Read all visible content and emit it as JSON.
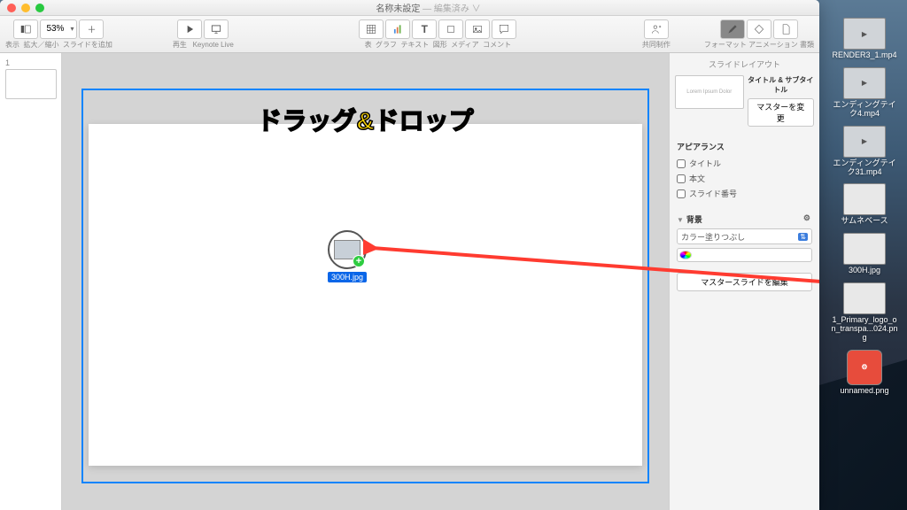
{
  "window": {
    "title_main": "名称未設定",
    "title_suffix": "— 編集済み ∨"
  },
  "toolbar": {
    "zoom_value": "53%",
    "view_label": "表示",
    "zoom_label": "拡大／縮小",
    "add_slide_label": "スライドを追加",
    "play_label": "再生",
    "keynote_live_label": "Keynote Live",
    "table_label": "表",
    "chart_label": "グラフ",
    "text_label": "テキスト",
    "shape_label": "図形",
    "media_label": "メディア",
    "comment_label": "コメント",
    "collab_label": "共同制作",
    "format_label": "フォーマット",
    "animate_label": "アニメーション",
    "document_label": "書類"
  },
  "slide_panel": {
    "slide_number": "1"
  },
  "overlay": {
    "text": "ドラッグ&ドロップ",
    "drop_filename": "300H.jpg"
  },
  "inspector": {
    "header": "スライドレイアウト",
    "layout_thumb_text": "Lorem Ipsum Dolor",
    "layout_name": "タイトル & サブタイトル",
    "change_master_btn": "マスターを変更",
    "appearance_title": "アピアランス",
    "chk_title": "タイトル",
    "chk_body": "本文",
    "chk_slide_number": "スライド番号",
    "background_title": "背景",
    "fill_select": "カラー塗りつぶし",
    "edit_master_btn": "マスタースライドを編集"
  },
  "desktop": {
    "files": [
      {
        "name": "RENDER3_1.mp4",
        "kind": "vid"
      },
      {
        "name": "エンディングテイク4.mp4",
        "kind": "vid"
      },
      {
        "name": "エンディングテイク31.mp4",
        "kind": "vid"
      },
      {
        "name": "サムネベース",
        "kind": "img"
      },
      {
        "name": "300H.jpg",
        "kind": "img"
      },
      {
        "name": "1_Primary_logo_on_transpa...024.png",
        "kind": "img"
      },
      {
        "name": "unnamed.png",
        "kind": "red"
      }
    ]
  }
}
